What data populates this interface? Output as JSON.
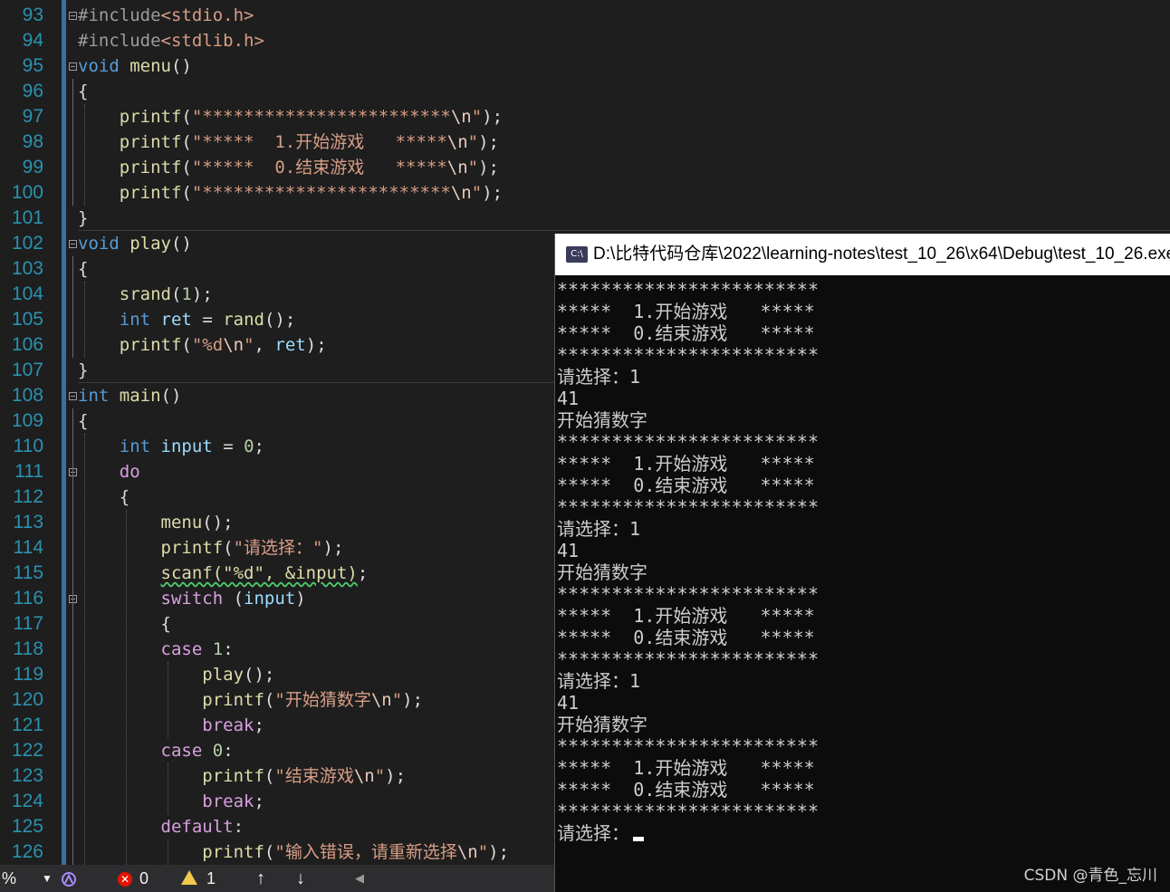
{
  "editor": {
    "line_numbers": [
      "93",
      "94",
      "95",
      "96",
      "97",
      "98",
      "99",
      "100",
      "101",
      "102",
      "103",
      "104",
      "105",
      "106",
      "107",
      "108",
      "109",
      "110",
      "111",
      "112",
      "113",
      "114",
      "115",
      "116",
      "117",
      "118",
      "119",
      "120",
      "121",
      "122",
      "123",
      "124",
      "125",
      "126"
    ],
    "lines": [
      [
        {
          "t": "#include",
          "c": "pp"
        },
        {
          "t": "<stdio.h>",
          "c": "inc"
        }
      ],
      [
        {
          "t": "#include",
          "c": "pp"
        },
        {
          "t": "<stdlib.h>",
          "c": "inc"
        }
      ],
      [
        {
          "t": "void",
          "c": "kw"
        },
        {
          "t": " "
        },
        {
          "t": "menu",
          "c": "fn"
        },
        {
          "t": "()"
        }
      ],
      [
        {
          "t": "{"
        }
      ],
      [
        {
          "t": "    "
        },
        {
          "t": "printf",
          "c": "fn"
        },
        {
          "t": "("
        },
        {
          "t": "\"************************",
          "c": "str"
        },
        {
          "t": "\\n",
          "c": "esc"
        },
        {
          "t": "\"",
          "c": "str"
        },
        {
          "t": ");"
        }
      ],
      [
        {
          "t": "    "
        },
        {
          "t": "printf",
          "c": "fn"
        },
        {
          "t": "("
        },
        {
          "t": "\"*****  1.开始游戏   *****",
          "c": "str"
        },
        {
          "t": "\\n",
          "c": "esc"
        },
        {
          "t": "\"",
          "c": "str"
        },
        {
          "t": ");"
        }
      ],
      [
        {
          "t": "    "
        },
        {
          "t": "printf",
          "c": "fn"
        },
        {
          "t": "("
        },
        {
          "t": "\"*****  0.结束游戏   *****",
          "c": "str"
        },
        {
          "t": "\\n",
          "c": "esc"
        },
        {
          "t": "\"",
          "c": "str"
        },
        {
          "t": ");"
        }
      ],
      [
        {
          "t": "    "
        },
        {
          "t": "printf",
          "c": "fn"
        },
        {
          "t": "("
        },
        {
          "t": "\"************************",
          "c": "str"
        },
        {
          "t": "\\n",
          "c": "esc"
        },
        {
          "t": "\"",
          "c": "str"
        },
        {
          "t": ");"
        }
      ],
      [
        {
          "t": "}"
        }
      ],
      [
        {
          "t": "void",
          "c": "kw"
        },
        {
          "t": " "
        },
        {
          "t": "play",
          "c": "fn"
        },
        {
          "t": "()"
        }
      ],
      [
        {
          "t": "{"
        }
      ],
      [
        {
          "t": "    "
        },
        {
          "t": "srand",
          "c": "fn"
        },
        {
          "t": "("
        },
        {
          "t": "1",
          "c": "num"
        },
        {
          "t": ");"
        }
      ],
      [
        {
          "t": "    "
        },
        {
          "t": "int",
          "c": "kw"
        },
        {
          "t": " "
        },
        {
          "t": "ret",
          "c": "var"
        },
        {
          "t": " = "
        },
        {
          "t": "rand",
          "c": "fn"
        },
        {
          "t": "();"
        }
      ],
      [
        {
          "t": "    "
        },
        {
          "t": "printf",
          "c": "fn"
        },
        {
          "t": "("
        },
        {
          "t": "\"%d",
          "c": "str"
        },
        {
          "t": "\\n",
          "c": "esc"
        },
        {
          "t": "\"",
          "c": "str"
        },
        {
          "t": ", "
        },
        {
          "t": "ret",
          "c": "var"
        },
        {
          "t": ");"
        }
      ],
      [
        {
          "t": "}"
        }
      ],
      [
        {
          "t": "int",
          "c": "kw"
        },
        {
          "t": " "
        },
        {
          "t": "main",
          "c": "fn"
        },
        {
          "t": "()"
        }
      ],
      [
        {
          "t": "{"
        }
      ],
      [
        {
          "t": "    "
        },
        {
          "t": "int",
          "c": "kw"
        },
        {
          "t": " "
        },
        {
          "t": "input",
          "c": "var"
        },
        {
          "t": " = "
        },
        {
          "t": "0",
          "c": "num"
        },
        {
          "t": ";"
        }
      ],
      [
        {
          "t": "    "
        },
        {
          "t": "do",
          "c": "ctl"
        }
      ],
      [
        {
          "t": "    {"
        }
      ],
      [
        {
          "t": "        "
        },
        {
          "t": "menu",
          "c": "fn"
        },
        {
          "t": "();"
        }
      ],
      [
        {
          "t": "        "
        },
        {
          "t": "printf",
          "c": "fn"
        },
        {
          "t": "("
        },
        {
          "t": "\"请选择：\"",
          "c": "str"
        },
        {
          "t": ");"
        }
      ],
      [
        {
          "t": "        "
        },
        {
          "t": "scanf(\"%d\", &input)",
          "c": "fn sq"
        },
        {
          "t": ";"
        }
      ],
      [
        {
          "t": "        "
        },
        {
          "t": "switch",
          "c": "ctl"
        },
        {
          "t": " ("
        },
        {
          "t": "input",
          "c": "var"
        },
        {
          "t": ")"
        }
      ],
      [
        {
          "t": "        {"
        }
      ],
      [
        {
          "t": "        "
        },
        {
          "t": "case",
          "c": "ctl"
        },
        {
          "t": " "
        },
        {
          "t": "1",
          "c": "num"
        },
        {
          "t": ":"
        }
      ],
      [
        {
          "t": "            "
        },
        {
          "t": "play",
          "c": "fn"
        },
        {
          "t": "();"
        }
      ],
      [
        {
          "t": "            "
        },
        {
          "t": "printf",
          "c": "fn"
        },
        {
          "t": "("
        },
        {
          "t": "\"开始猜数字",
          "c": "str"
        },
        {
          "t": "\\n",
          "c": "esc"
        },
        {
          "t": "\"",
          "c": "str"
        },
        {
          "t": ");"
        }
      ],
      [
        {
          "t": "            "
        },
        {
          "t": "break",
          "c": "ctl"
        },
        {
          "t": ";"
        }
      ],
      [
        {
          "t": "        "
        },
        {
          "t": "case",
          "c": "ctl"
        },
        {
          "t": " "
        },
        {
          "t": "0",
          "c": "num"
        },
        {
          "t": ":"
        }
      ],
      [
        {
          "t": "            "
        },
        {
          "t": "printf",
          "c": "fn"
        },
        {
          "t": "("
        },
        {
          "t": "\"结束游戏",
          "c": "str"
        },
        {
          "t": "\\n",
          "c": "esc"
        },
        {
          "t": "\"",
          "c": "str"
        },
        {
          "t": ");"
        }
      ],
      [
        {
          "t": "            "
        },
        {
          "t": "break",
          "c": "ctl"
        },
        {
          "t": ";"
        }
      ],
      [
        {
          "t": "        "
        },
        {
          "t": "default",
          "c": "ctl"
        },
        {
          "t": ":"
        }
      ],
      [
        {
          "t": "            "
        },
        {
          "t": "printf",
          "c": "fn"
        },
        {
          "t": "("
        },
        {
          "t": "\"输入错误，请重新选择",
          "c": "str"
        },
        {
          "t": "\\n",
          "c": "esc"
        },
        {
          "t": "\"",
          "c": "str"
        },
        {
          "t": ");"
        }
      ]
    ]
  },
  "statusbar": {
    "zoom": "%",
    "zoom_dropdown_icon": "chevron-down-icon",
    "health_icon": "intellicode-icon",
    "error_icon": "error-icon",
    "error_count": "0",
    "warning_icon": "warning-icon",
    "warning_count": "1",
    "up_arrow": "↑",
    "down_arrow": "↓",
    "scroll_left_arrow": "◀"
  },
  "console": {
    "title": "D:\\比特代码仓库\\2022\\learning-notes\\test_10_26\\x64\\Debug\\test_10_26.exe",
    "icon": "console-app-icon",
    "icon_text": "C:\\",
    "lines": [
      "************************",
      "*****  1.开始游戏   *****",
      "*****  0.结束游戏   *****",
      "************************",
      "请选择：1",
      "41",
      "开始猜数字",
      "************************",
      "*****  1.开始游戏   *****",
      "*****  0.结束游戏   *****",
      "************************",
      "请选择：1",
      "41",
      "开始猜数字",
      "************************",
      "*****  1.开始游戏   *****",
      "*****  0.结束游戏   *****",
      "************************",
      "请选择：1",
      "41",
      "开始猜数字",
      "************************",
      "*****  1.开始游戏   *****",
      "*****  0.结束游戏   *****",
      "************************",
      "请选择："
    ]
  },
  "watermark": "CSDN @青色_忘川"
}
